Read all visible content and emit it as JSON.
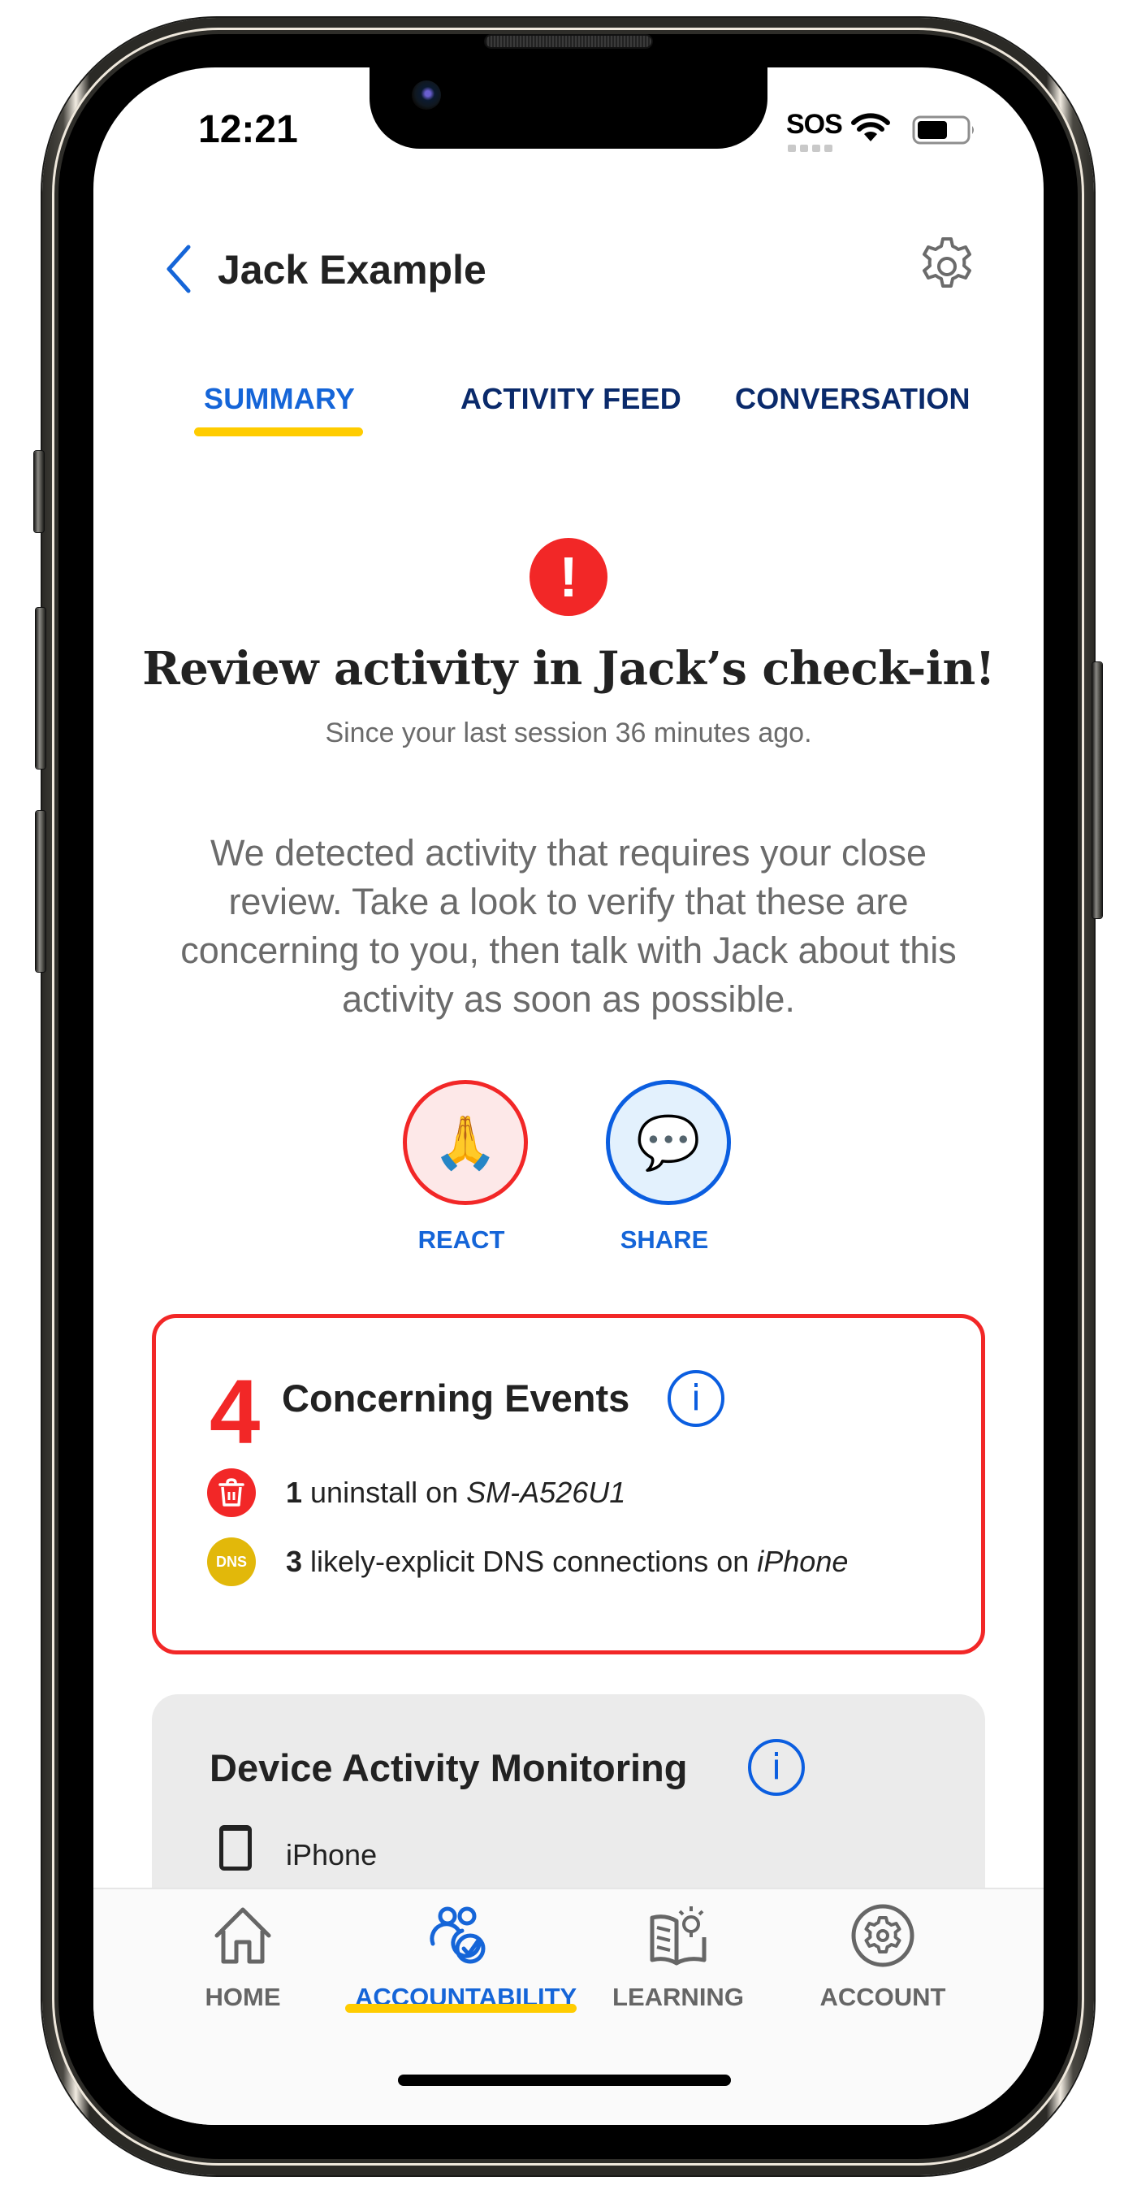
{
  "status_bar": {
    "time": "12:21",
    "carrier": "SOS",
    "wifi_icon": "wifi-icon",
    "battery_icon": "battery-icon",
    "battery_level_percent": 50
  },
  "header": {
    "back_icon": "chevron-left-icon",
    "title": "Jack Example",
    "settings_icon": "gear-icon"
  },
  "tabs": [
    {
      "label": "SUMMARY",
      "active": true
    },
    {
      "label": "ACTIVITY FEED",
      "active": false
    },
    {
      "label": "CONVERSATION",
      "active": false
    }
  ],
  "alert": {
    "icon": "exclamation-icon",
    "icon_glyph": "!",
    "title": "Review activity in Jack’s check-in!",
    "subtitle": "Since your last session 36 minutes ago.",
    "body": "We detected activity that requires your close review. Take a look to verify that these are concerning to you, then talk with Jack about this activity as soon as possible."
  },
  "actions": [
    {
      "label": "REACT",
      "icon": "praying-hands-icon",
      "glyph": "🙏"
    },
    {
      "label": "SHARE",
      "icon": "speech-bubble-icon",
      "glyph": "💬"
    }
  ],
  "concerning_events": {
    "count": "4",
    "heading": "Concerning Events",
    "info_glyph": "i",
    "items": [
      {
        "icon": "trash-icon",
        "count": "1",
        "text": " uninstall on ",
        "device": "SM-A526U1"
      },
      {
        "icon": "dns-icon",
        "icon_label": "DNS",
        "count": "3",
        "text": " likely-explicit DNS connections on ",
        "device": "iPhone"
      }
    ]
  },
  "device_monitoring": {
    "heading": "Device Activity Monitoring",
    "info_glyph": "i",
    "devices": [
      {
        "icon": "phone-icon",
        "name": "iPhone"
      }
    ]
  },
  "bottom_nav": [
    {
      "label": "HOME",
      "icon": "home-icon",
      "active": false
    },
    {
      "label": "ACCOUNTABILITY",
      "icon": "accountability-icon",
      "active": true
    },
    {
      "label": "LEARNING",
      "icon": "learning-icon",
      "active": false
    },
    {
      "label": "ACCOUNT",
      "icon": "account-gear-icon",
      "active": false
    }
  ],
  "colors": {
    "accent_blue": "#1565d8",
    "tab_navy": "#0a2a6b",
    "alert_red": "#f22727",
    "highlight_yellow": "#ffcc00",
    "dns_gold": "#e2b80a"
  }
}
